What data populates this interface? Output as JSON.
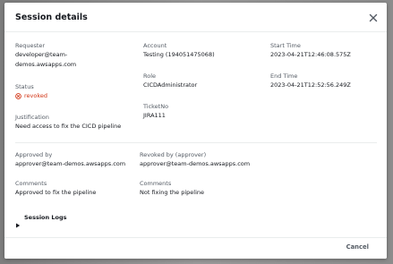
{
  "modal": {
    "title": "Session details",
    "close_icon": "close-icon"
  },
  "details": {
    "requester_label": "Requester",
    "requester_line1": "developer@team-",
    "requester_line2": "demos.awsapps.com",
    "status_label": "Status",
    "status_value": "revoked",
    "status_icon": "revoked-status-icon",
    "status_color": "#d13212",
    "justification_label": "Justification",
    "justification_value": "Need access to fix the CICD pipeline",
    "account_label": "Account",
    "account_value": "Testing (194051475068)",
    "role_label": "Role",
    "role_value": "CICDAdministrator",
    "ticket_label": "TicketNo",
    "ticket_value": "JIRA111",
    "start_label": "Start Time",
    "start_value": "2023-04-21T12:46:08.575Z",
    "end_label": "End Time",
    "end_value": "2023-04-21T12:52:56.249Z"
  },
  "approval": {
    "approved_by_label": "Approved by",
    "approved_by_value": "approver@team-demos.awsapps.com",
    "approve_comments_label": "Comments",
    "approve_comments_value": "Approved to fix the pipeline",
    "revoked_by_label": "Revoked by (approver)",
    "revoked_by_value": "approver@team-demos.awsapps.com",
    "revoke_comments_label": "Comments",
    "revoke_comments_value": "Not fixing the pipeline"
  },
  "session_logs": {
    "label": "Session Logs",
    "icon": "caret-right-icon"
  },
  "footer": {
    "cancel_label": "Cancel"
  }
}
